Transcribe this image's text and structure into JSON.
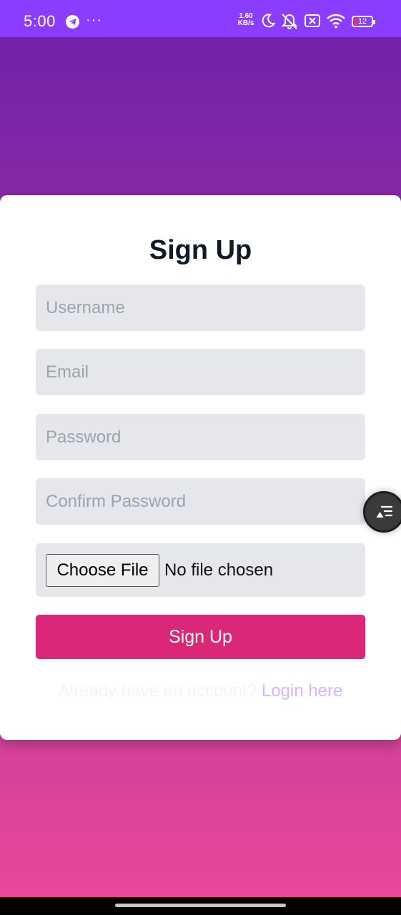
{
  "status_bar": {
    "time": "5:00",
    "more_indicator": "···",
    "net_speed_value": "1.60",
    "net_speed_unit": "KB/s",
    "battery_level": "12",
    "icons": [
      "telegram-icon",
      "moon-icon",
      "mute-icon",
      "xbox-icon",
      "wifi-icon",
      "battery-icon"
    ]
  },
  "form": {
    "title": "Sign Up",
    "username_placeholder": "Username",
    "email_placeholder": "Email",
    "password_placeholder": "Password",
    "confirm_password_placeholder": "Confirm Password",
    "choose_file_label": "Choose File",
    "file_status": "No file chosen",
    "submit_label": "Sign Up",
    "login_prompt": "Already have an account?",
    "login_link": "Login here"
  },
  "floating_button": {
    "icon": "menu-lines-icon"
  },
  "colors": {
    "status_bar": "#8b3dff",
    "background_top": "#6b21a8",
    "background_bottom": "#ec4899",
    "card": "#ffffff",
    "input_bg": "#e5e7eb",
    "submit_button": "#db2777",
    "login_link": "#d8b4fe",
    "title_text": "#111827"
  }
}
